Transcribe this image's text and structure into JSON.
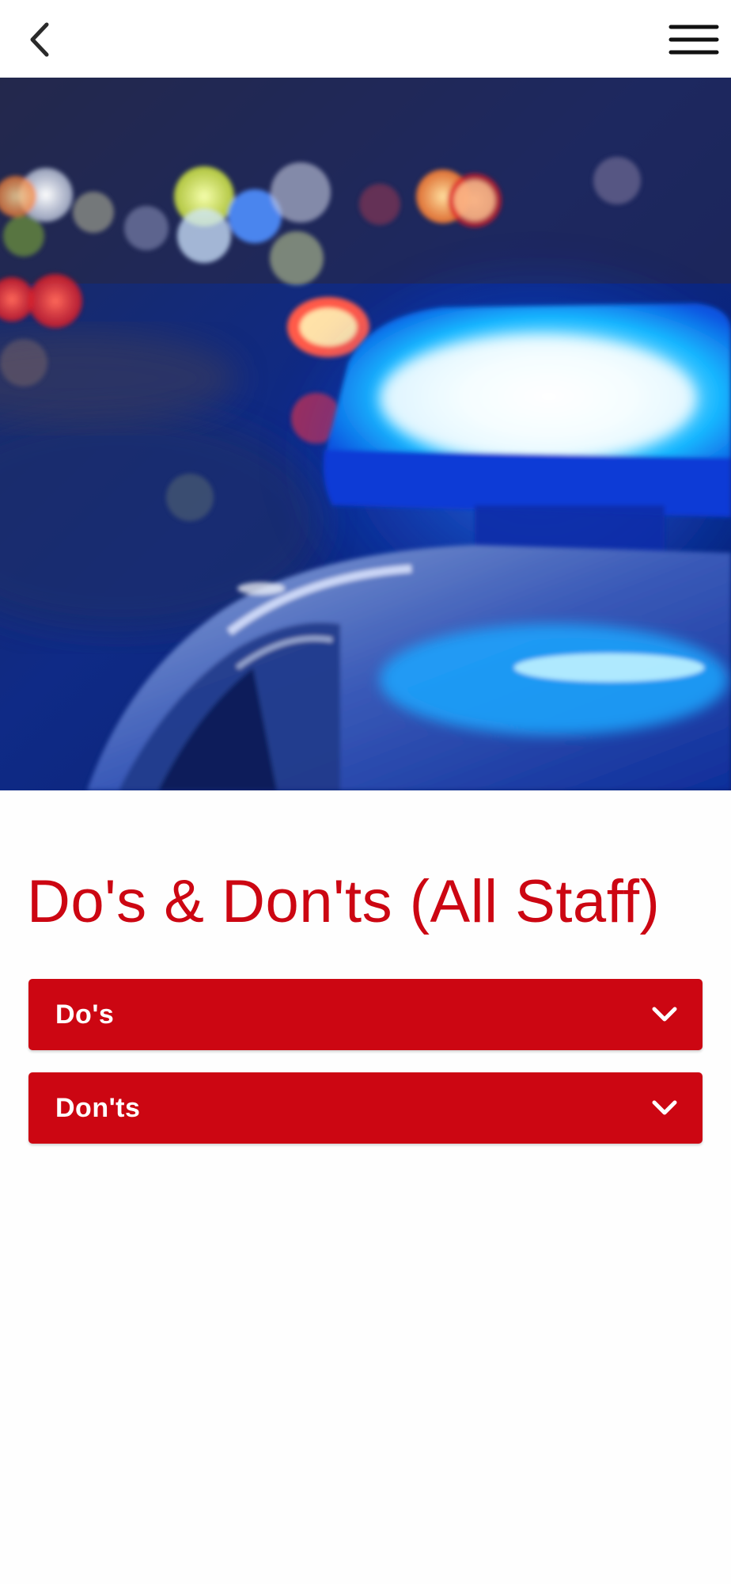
{
  "nav": {
    "back_icon": "chevron-left-icon",
    "menu_icon": "hamburger-menu-icon"
  },
  "hero": {
    "image": "police-car-blue-siren-night-bokeh"
  },
  "page": {
    "title": "Do's & Don'ts (All Staff)"
  },
  "accordions": [
    {
      "label": "Do's",
      "icon": "chevron-down-icon"
    },
    {
      "label": "Don'ts",
      "icon": "chevron-down-icon"
    }
  ],
  "colors": {
    "accent": "#cc0612",
    "title": "#cc0612",
    "accordion_bg": "#cc0612",
    "icon_dark": "#1a1a1a",
    "white": "#ffffff"
  }
}
